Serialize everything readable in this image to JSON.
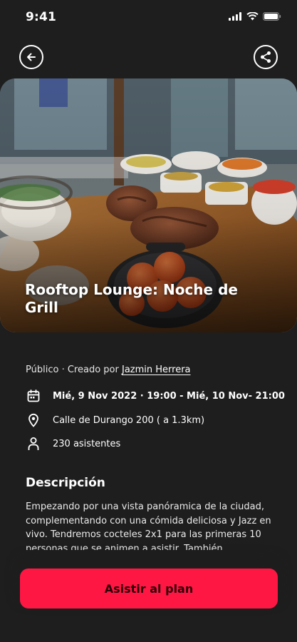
{
  "status_bar": {
    "time": "9:41"
  },
  "event": {
    "title": "Rooftop Lounge: Noche de Grill",
    "visibility": "Público",
    "created_by_prefix": "Creado por",
    "creator": "Jazmin Herrera",
    "date": "Mié, 9 Nov 2022 · 19:00  - Mié, 10 Nov- 21:00",
    "location": "Calle de Durango 200 ( a 1.3km)",
    "attendees": "230 asistentes"
  },
  "description": {
    "heading": "Descripción",
    "text": "Empezando por una vista panóramica de la ciudad, complementando con una cómida deliciosa y Jazz en vivo. Tendremos cocteles 2x1 para las primeras 10 personas que se animen a asistir. También"
  },
  "cta": {
    "label": "Asistir al plan"
  },
  "colors": {
    "accent": "#ff1744",
    "background": "#1e1e1e"
  },
  "icons": [
    "back-arrow-icon",
    "share-icon",
    "calendar-icon",
    "location-pin-icon",
    "person-icon"
  ]
}
